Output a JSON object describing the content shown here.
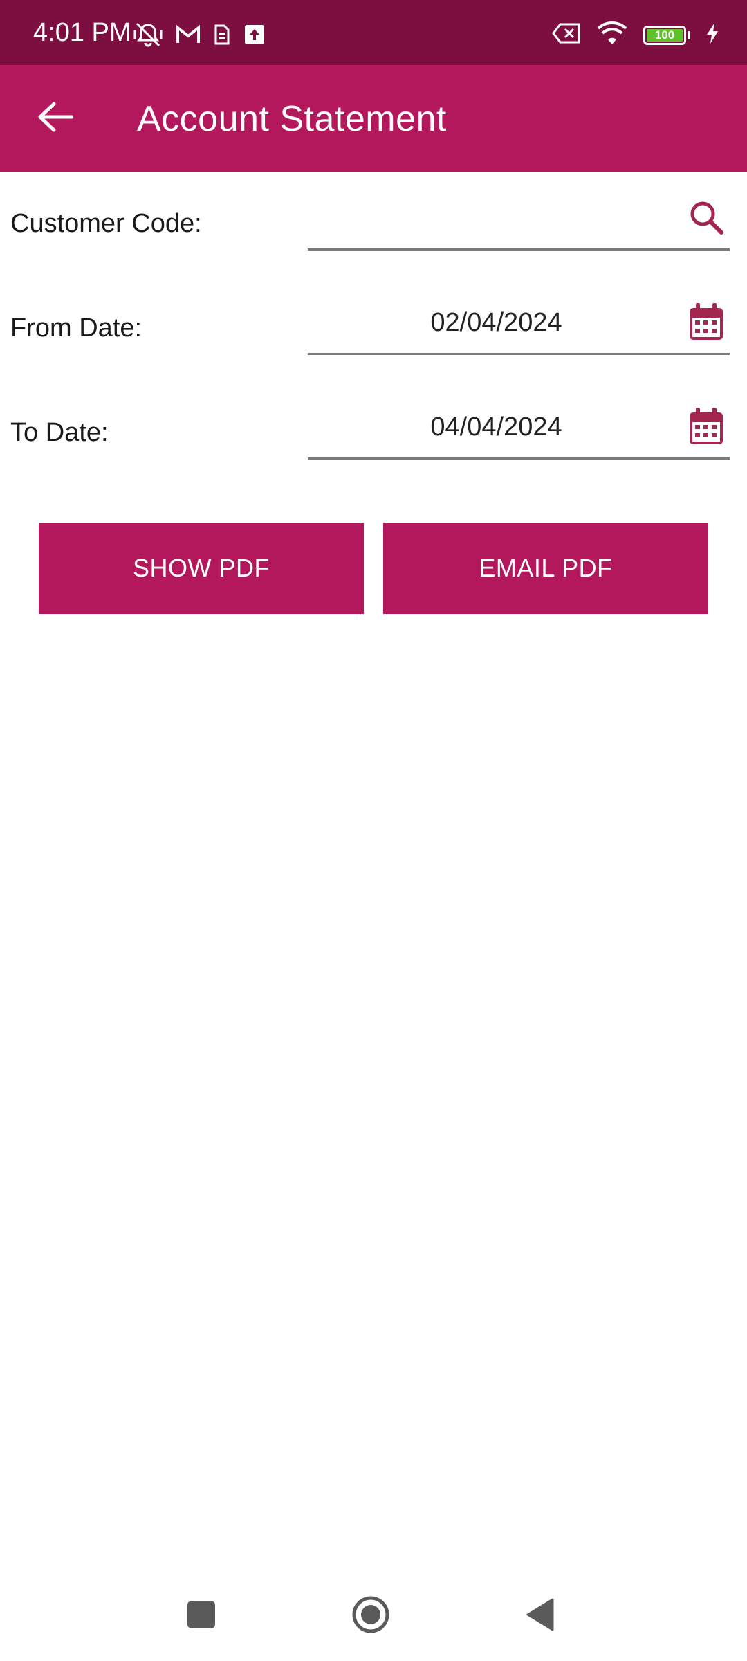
{
  "status_bar": {
    "time": "4:01 PM",
    "left_icons": [
      "vibrate-silent-icon",
      "gmail-icon",
      "sim-icon",
      "upload-icon"
    ],
    "right_icons": [
      "no-data-icon",
      "wifi-icon",
      "battery-icon",
      "charging-icon"
    ],
    "battery_level": "100"
  },
  "app_bar": {
    "title": "Account Statement",
    "back_icon": "back-arrow-icon"
  },
  "form": {
    "customer_code": {
      "label": "Customer Code:",
      "value": "",
      "icon": "search-icon"
    },
    "from_date": {
      "label": "From Date:",
      "value": "02/04/2024",
      "icon": "calendar-icon"
    },
    "to_date": {
      "label": "To Date:",
      "value": "04/04/2024",
      "icon": "calendar-icon"
    }
  },
  "actions": {
    "show_pdf": "SHOW PDF",
    "email_pdf": "EMAIL PDF"
  },
  "nav_bar": {
    "items": [
      "recents-icon",
      "home-icon",
      "back-icon"
    ]
  },
  "colors": {
    "status_bar": "#7d0f40",
    "primary": "#b3185c",
    "icon_accent": "#a3264f"
  }
}
